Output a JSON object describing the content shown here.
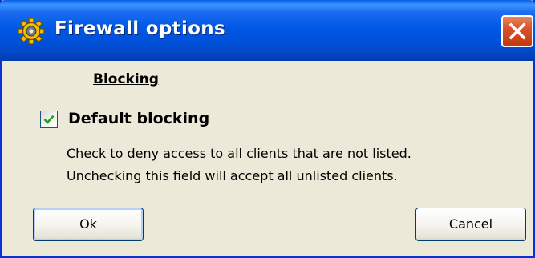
{
  "window": {
    "title": "Firewall options",
    "icon": "gear-icon",
    "close_icon": "close-icon",
    "accent_color": "#0054E3",
    "background_color": "#ECE9D8"
  },
  "section": {
    "heading": "Blocking"
  },
  "default_blocking": {
    "label": "Default blocking",
    "checked": true,
    "help_line_1": "Check to deny access to all clients that are not listed.",
    "help_line_2": "Unchecking this field will accept all unlisted clients."
  },
  "buttons": {
    "ok_label": "Ok",
    "cancel_label": "Cancel"
  }
}
